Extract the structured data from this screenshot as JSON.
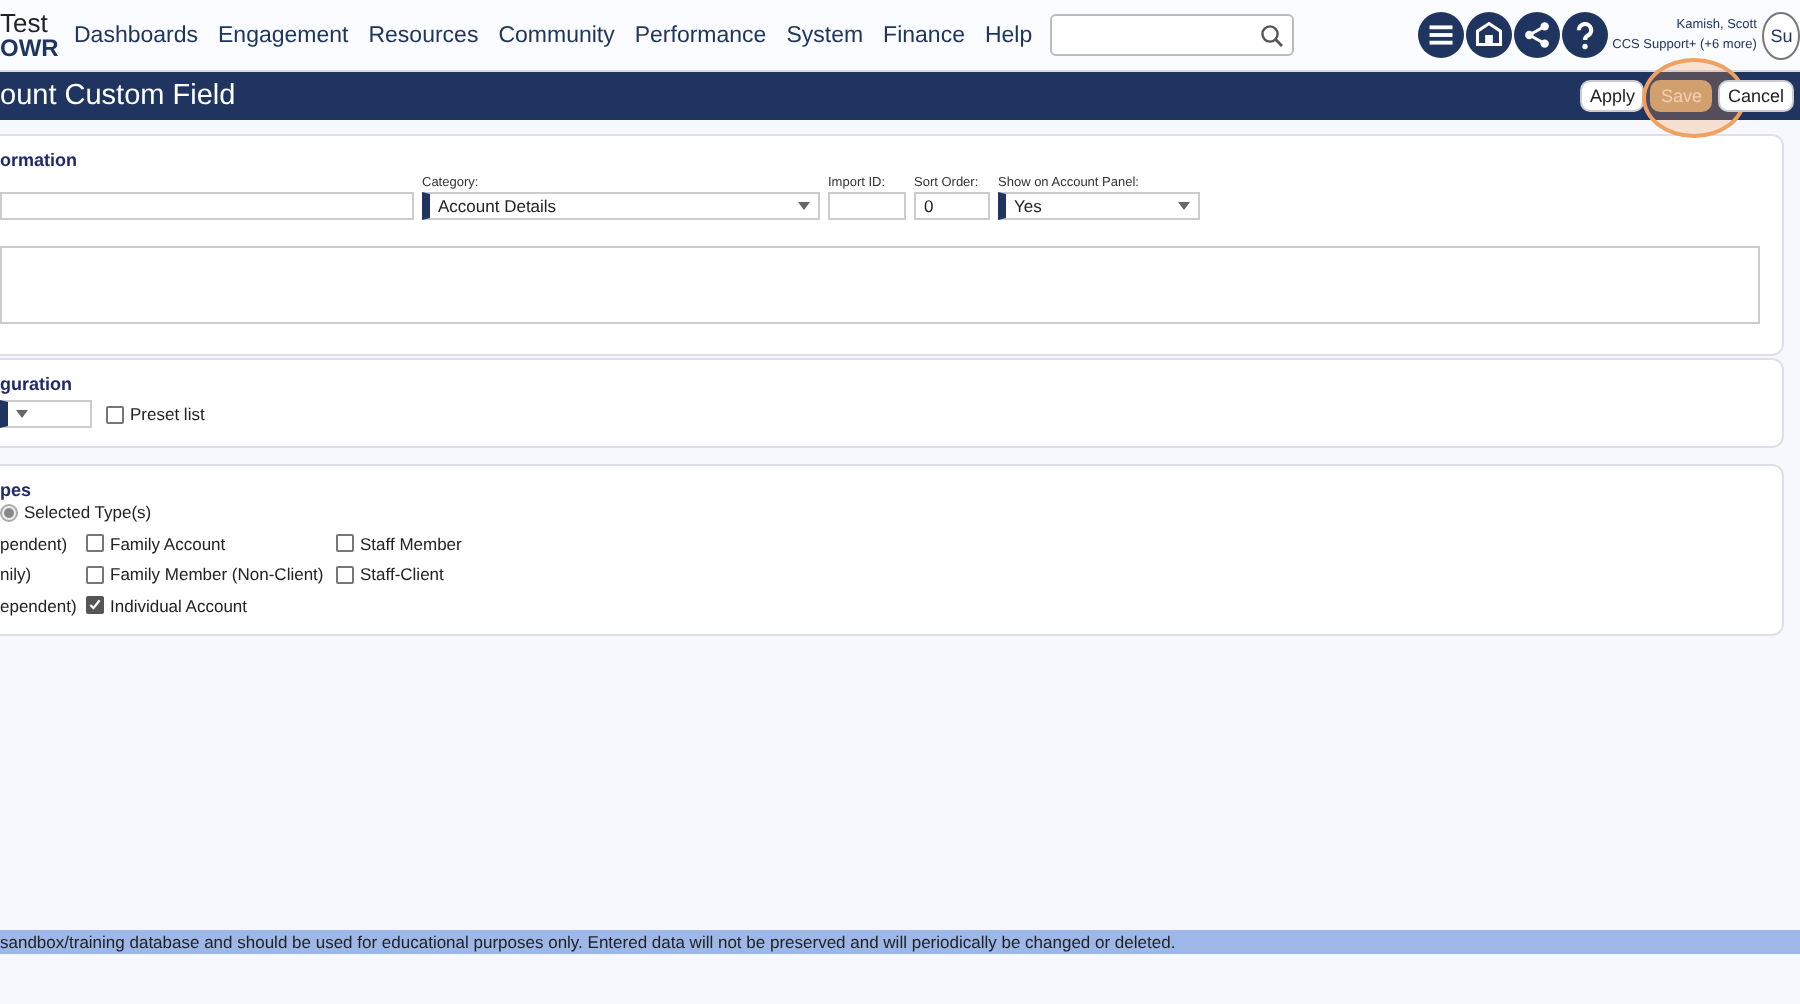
{
  "logo": {
    "line_1": "Test",
    "line_2": "OWR"
  },
  "nav": [
    "Dashboards",
    "Engagement",
    "Resources",
    "Community",
    "Performance",
    "System",
    "Finance",
    "Help"
  ],
  "user": {
    "name": "Kamish, Scott",
    "role": "CCS Support+ (+6 more)",
    "avatar_text": "Su"
  },
  "title": "ount Custom Field",
  "actions": [
    {
      "label": "Apply",
      "highlighted": false
    },
    {
      "label": "Save",
      "highlighted": true
    },
    {
      "label": "Cancel",
      "highlighted": false
    }
  ],
  "information": {
    "heading": "ormation",
    "category": {
      "label": "Category:",
      "value": "Account Details"
    },
    "import_id": {
      "label": "Import ID:"
    },
    "sort_order": {
      "label": "Sort Order:",
      "value": "0"
    },
    "show_on_panel": {
      "label": "Show on Account Panel:",
      "value": "Yes"
    }
  },
  "configuration": {
    "heading": "guration",
    "preset": {
      "label": "Preset list",
      "checked": false
    }
  },
  "types": {
    "heading": "pes",
    "radio": {
      "label": "Selected Type(s)",
      "selected": true
    },
    "rows": [
      [
        {
          "kind": "text",
          "label": "pendent)"
        },
        {
          "kind": "checkbox",
          "label": "Family Account",
          "checked": false
        },
        {
          "kind": "checkbox",
          "label": "Staff Member",
          "checked": false
        }
      ],
      [
        {
          "kind": "text",
          "label": "nily)"
        },
        {
          "kind": "checkbox",
          "label": "Family Member (Non-Client)",
          "checked": false
        },
        {
          "kind": "checkbox",
          "label": "Staff-Client",
          "checked": false
        }
      ],
      [
        {
          "kind": "text",
          "label": "ependent)"
        },
        {
          "kind": "checkbox",
          "label": "Individual Account",
          "checked": true
        }
      ]
    ]
  },
  "banner": "sandbox/training database and should be used for educational purposes only. Entered data will not be preserved and will periodically be changed or deleted."
}
